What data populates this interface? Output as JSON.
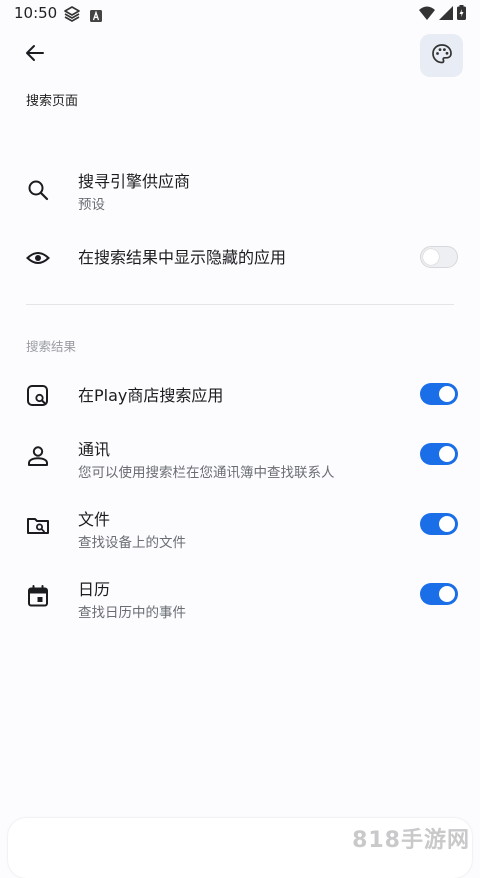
{
  "status_bar": {
    "time": "10:50"
  },
  "header": {
    "title": "搜索页面"
  },
  "settings": [
    {
      "icon": "search-icon",
      "title": "搜寻引擎供应商",
      "subtitle": "预设"
    },
    {
      "icon": "eye-icon",
      "title": "在搜索结果中显示隐藏的应用",
      "toggle": false
    }
  ],
  "section": {
    "header": "搜索结果"
  },
  "results": [
    {
      "icon": "play-store-search-icon",
      "title": "在Play商店搜索应用",
      "toggle": true
    },
    {
      "icon": "contacts-person-icon",
      "title": "通讯",
      "subtitle": "您可以使用搜索栏在您通讯簿中查找联系人",
      "toggle": true
    },
    {
      "icon": "folder-search-icon",
      "title": "文件",
      "subtitle": "查找设备上的文件",
      "toggle": true
    },
    {
      "icon": "calendar-icon",
      "title": "日历",
      "subtitle": "查找日历中的事件",
      "toggle": true
    }
  ],
  "watermark": "818手游网",
  "colors": {
    "accent": "#1a6ee8",
    "background": "#fcfcfe",
    "palette_button_bg": "#e8ecf4"
  }
}
